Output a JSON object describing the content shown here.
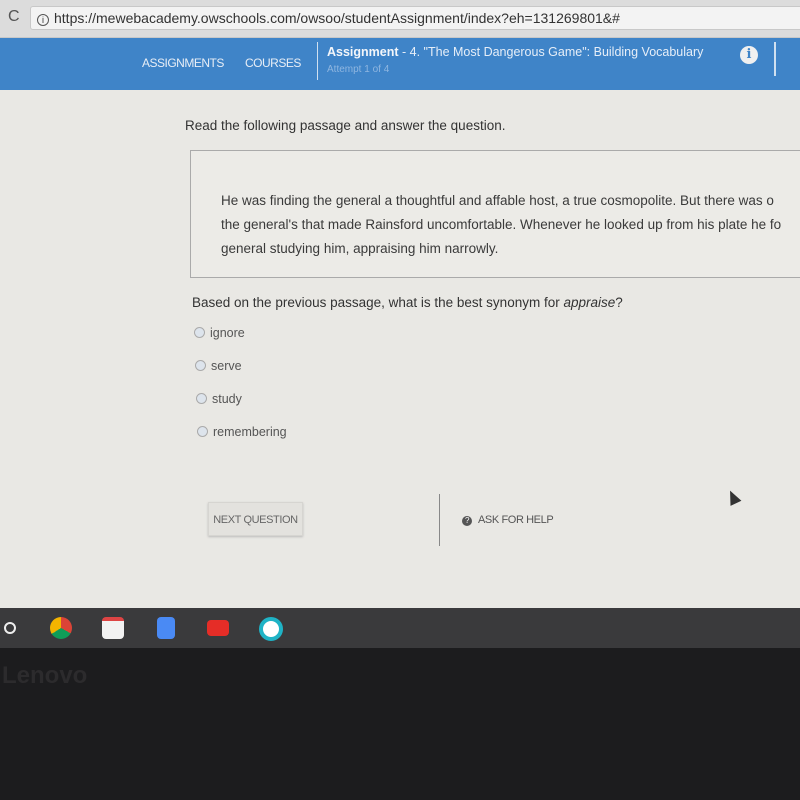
{
  "browser": {
    "url": "https://mewebacademy.owschools.com/owsoo/studentAssignment/index?eh=131269801&#"
  },
  "nav": {
    "assignments": "ASSIGNMENTS",
    "courses": "COURSES",
    "assignment_label": "Assignment",
    "assignment_title": " - 4. \"The Most Dangerous Game\": Building Vocabulary",
    "attempt": "Attempt 1 of 4",
    "accent": "#3f84c8"
  },
  "main": {
    "prompt": "Read the following passage and answer the question.",
    "passage_lines": [
      "He was finding the general a thoughtful and affable host, a true cosmopolite. But there was o",
      "the general's that made Rainsford uncomfortable. Whenever he looked up from his plate he fo",
      "general studying him, appraising him narrowly."
    ],
    "question_prefix": "Based on the previous passage, what is the best synonym for ",
    "question_word": "appraise",
    "question_suffix": "?",
    "options": [
      "ignore",
      "serve",
      "study",
      "remembering"
    ],
    "next_button": "NEXT QUESTION",
    "help_button": "ASK FOR HELP"
  },
  "taskbar": {
    "apps": [
      "chrome-icon",
      "gmail-icon",
      "docs-icon",
      "youtube-icon",
      "play-store-icon"
    ]
  },
  "bezel": {
    "logo": "Lenovo"
  }
}
